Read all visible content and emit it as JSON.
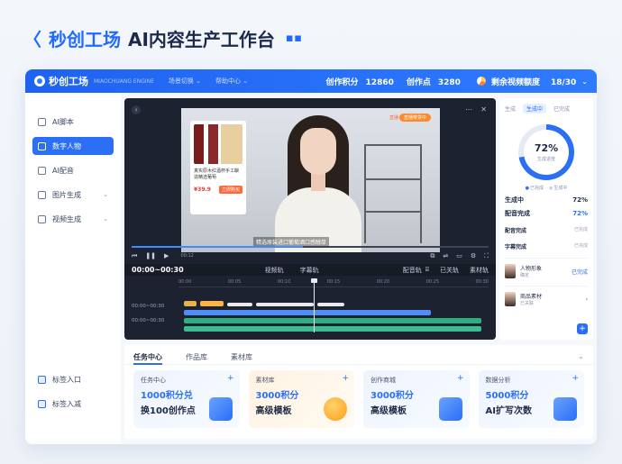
{
  "hero": {
    "chevron": "〈",
    "brand": "秒创工场",
    "title": "AI内容生产工作台",
    "dots": "▪ ▪"
  },
  "topbar": {
    "logo": "秒创工场",
    "subtitle": "MIAOCHUANG ENGINE",
    "menu": [
      "场景切换",
      "帮助中心"
    ],
    "stats": [
      {
        "label": "创作积分",
        "value": "12860"
      },
      {
        "label": "创作点",
        "value": "3280"
      }
    ],
    "quota_label": "剩余视频额度",
    "quota_value": "18/30"
  },
  "sidebar": {
    "items": [
      {
        "label": "AI脚本",
        "icon": "script-icon",
        "active": false,
        "arrow": ""
      },
      {
        "label": "数字人物",
        "icon": "person-icon",
        "active": true,
        "arrow": ""
      },
      {
        "label": "AI配音",
        "icon": "voice-icon",
        "active": false,
        "arrow": ""
      },
      {
        "label": "图片生成",
        "icon": "image-icon",
        "active": false,
        "arrow": "⌄"
      },
      {
        "label": "视频生成",
        "icon": "video-icon",
        "active": false,
        "arrow": "⌄"
      }
    ],
    "bottom": [
      {
        "label": "标签入口",
        "icon": "tag-icon"
      },
      {
        "label": "标签入减",
        "icon": "shield-icon"
      }
    ]
  },
  "editor": {
    "product": {
      "desc": "真实原木红酒杯手工酿造精选葡萄",
      "price": "¥39.9",
      "buy": "立即购买"
    },
    "live_label": "直播",
    "live_tag": "直播带货中",
    "subtitle_text": "精选原装进口葡萄酒口感醇厚",
    "player_time": "00:12",
    "timeline_range": "00:00~00:30",
    "timeline_tabs": [
      "视频轨",
      "字幕轨"
    ],
    "timeline_right": [
      "配音轨",
      "已关轨",
      "素材轨"
    ],
    "ruler": [
      "00:00",
      "00:05",
      "00:10",
      "00:15",
      "00:20",
      "00:25",
      "00:30"
    ],
    "track_labels": [
      "00:00~00:30",
      "00:00~00:30"
    ]
  },
  "right_panel": {
    "tabs": [
      "生成",
      "生成中",
      "已完成"
    ],
    "ring_value": "72%",
    "ring_label": "生成进度",
    "progress": 0.72,
    "legend": [
      "已完成",
      "生成中"
    ],
    "rows": [
      {
        "label": "生成中",
        "value": "72%"
      },
      {
        "label": "配音完成",
        "value": "72%"
      }
    ],
    "subs": [
      {
        "label": "配音完成",
        "meta": "已完成"
      },
      {
        "label": "字幕完成",
        "meta": "已完成"
      }
    ],
    "cards": [
      {
        "title": "人物形象",
        "sub": "确定",
        "action": "已完成"
      },
      {
        "title": "商品素材",
        "sub": "已关联",
        "action": ""
      }
    ],
    "fab": "+"
  },
  "tasks": {
    "tabs": [
      "任务中心",
      "作品库",
      "素材库"
    ],
    "cards": [
      {
        "title": "任务中心",
        "line1": "1000积分兑",
        "line2": "换100创作点",
        "style": "blue"
      },
      {
        "title": "素材库",
        "line1": "3000积分",
        "line2": "高级模板",
        "style": "orange"
      },
      {
        "title": "创作商城",
        "line1": "3000积分",
        "line2": "高级模板",
        "style": "blue"
      },
      {
        "title": "数据分析",
        "line1": "5000积分",
        "line2": "AI扩写次数",
        "style": "blue"
      }
    ]
  },
  "colors": {
    "accent": "#2a6ff5",
    "topbar": "#1e63f0",
    "editor_bg": "#1c2230"
  }
}
